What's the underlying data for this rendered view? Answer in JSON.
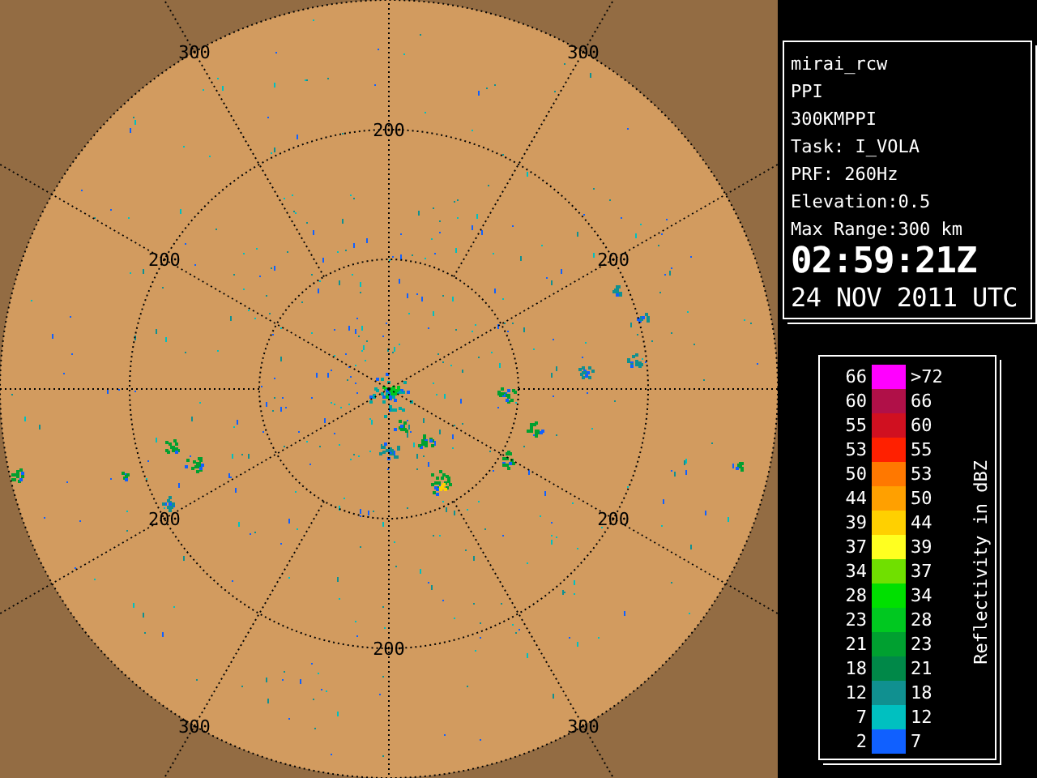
{
  "radar": {
    "rings": [
      {
        "kind": "plain"
      },
      {
        "kind": "labeled",
        "labels": [
          "200",
          "200",
          "200",
          "200",
          "200",
          "200"
        ]
      },
      {
        "kind": "labeled",
        "labels": [
          "300",
          "300",
          "300",
          "300"
        ]
      }
    ]
  },
  "info": {
    "lines": [
      "mirai_rcw",
      "PPI",
      "300KMPPI",
      "Task: I_VOLA",
      "PRF: 260Hz",
      "Elevation:0.5",
      "Max Range:300 km"
    ],
    "time": "02:59:21Z",
    "date": "24 NOV 2011 UTC"
  },
  "legend": {
    "title": "Reflectivity in dBZ",
    "rows": [
      {
        "low": "66",
        "high": ">72",
        "color": "#ff00ff"
      },
      {
        "low": "60",
        "high": "66",
        "color": "#b01048"
      },
      {
        "low": "55",
        "high": "60",
        "color": "#d01020"
      },
      {
        "low": "53",
        "high": "55",
        "color": "#ff2000"
      },
      {
        "low": "50",
        "high": "53",
        "color": "#ff7800"
      },
      {
        "low": "44",
        "high": "50",
        "color": "#ffa000"
      },
      {
        "low": "39",
        "high": "44",
        "color": "#ffd000"
      },
      {
        "low": "37",
        "high": "39",
        "color": "#ffff20"
      },
      {
        "low": "34",
        "high": "37",
        "color": "#70e000"
      },
      {
        "low": "28",
        "high": "34",
        "color": "#00e000"
      },
      {
        "low": "23",
        "high": "28",
        "color": "#00c820"
      },
      {
        "low": "21",
        "high": "23",
        "color": "#00a030"
      },
      {
        "low": "18",
        "high": "21",
        "color": "#008848"
      },
      {
        "low": "12",
        "high": "18",
        "color": "#109090"
      },
      {
        "low": "7",
        "high": "12",
        "color": "#00c0c0"
      },
      {
        "low": "2",
        "high": "7",
        "color": "#1060ff"
      }
    ]
  }
}
